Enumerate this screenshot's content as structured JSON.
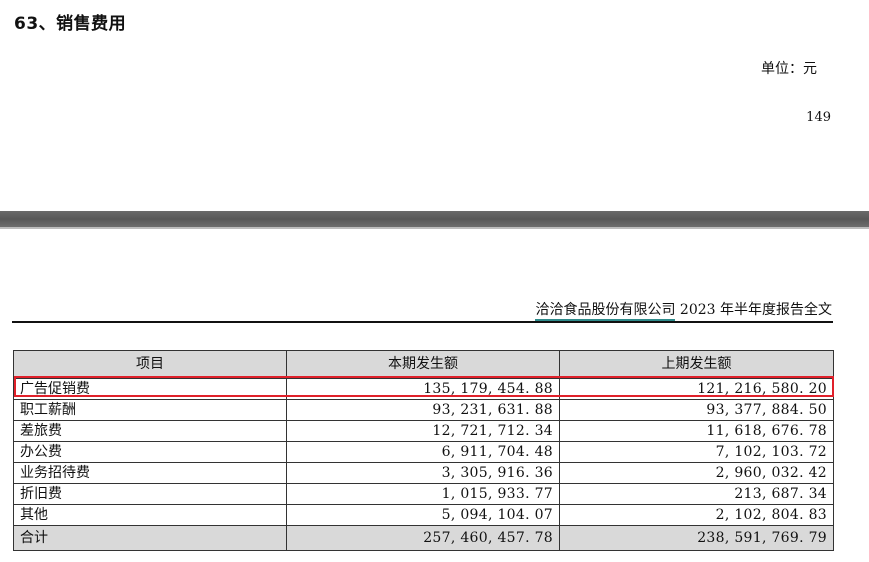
{
  "section_title": "63、销售费用",
  "unit_label": "单位：元",
  "page_number": "149",
  "report_header": {
    "company": "洽洽食品股份有限公司",
    "title": " 2023 年半年度报告全文"
  },
  "table": {
    "columns": [
      "项目",
      "本期发生额",
      "上期发生额"
    ],
    "rows": [
      {
        "item": "广告促销费",
        "current": "135, 179, 454. 88",
        "previous": "121, 216, 580. 20"
      },
      {
        "item": "职工薪酬",
        "current": "93, 231, 631. 88",
        "previous": "93, 377, 884. 50"
      },
      {
        "item": "差旅费",
        "current": "12, 721, 712. 34",
        "previous": "11, 618, 676. 78"
      },
      {
        "item": "办公费",
        "current": "6, 911, 704. 48",
        "previous": "7, 102, 103. 72"
      },
      {
        "item": "业务招待费",
        "current": "3, 305, 916. 36",
        "previous": "2, 960, 032. 42"
      },
      {
        "item": "折旧费",
        "current": "1, 015, 933. 77",
        "previous": "213, 687. 34"
      },
      {
        "item": "其他",
        "current": "5, 094, 104. 07",
        "previous": "2, 102, 804. 83"
      }
    ],
    "total": {
      "item": "合计",
      "current": "257, 460, 457. 78",
      "previous": "238, 591, 769. 79"
    }
  },
  "colors": {
    "highlight": "#e0202a",
    "header_bg": "#d9d9d9",
    "divider": "#5f5f5f",
    "company_underline": "#2e8b8b"
  }
}
